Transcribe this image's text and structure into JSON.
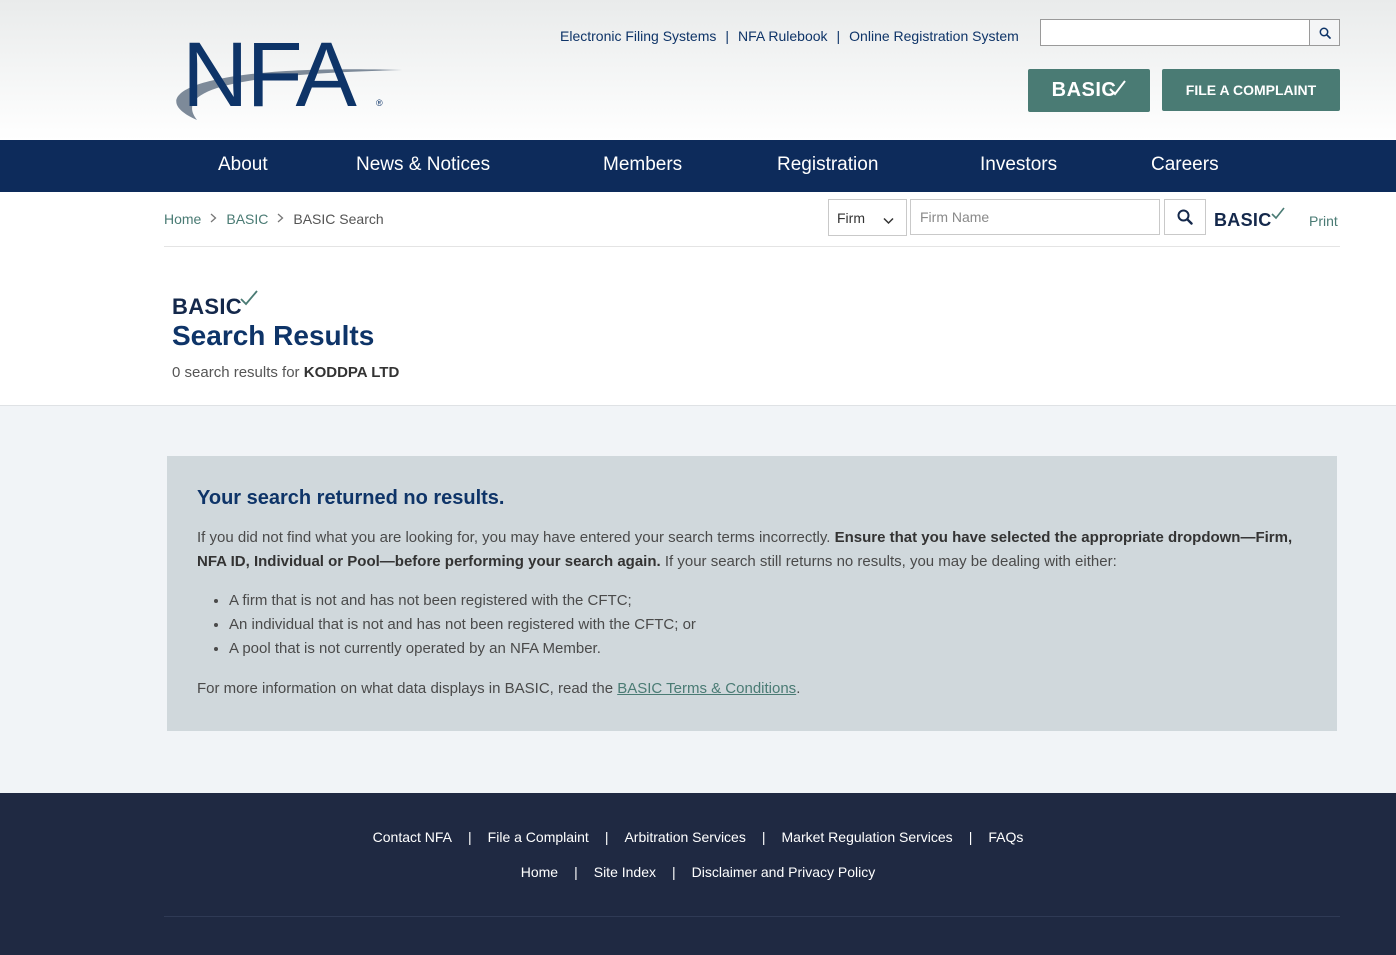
{
  "header": {
    "logo_text": "NFA",
    "utility_links": [
      "Electronic Filing Systems",
      "NFA Rulebook",
      "Online Registration System"
    ],
    "utility_separator": "|",
    "search_value": "",
    "basic_button": "BASIC",
    "complaint_button": "FILE A COMPLAINT"
  },
  "nav": {
    "items": [
      "About",
      "News & Notices",
      "Members",
      "Registration",
      "Investors",
      "Careers"
    ]
  },
  "breadcrumb": {
    "items": [
      "Home",
      "BASIC",
      "BASIC Search"
    ]
  },
  "basic_search": {
    "type_selected": "Firm",
    "name_placeholder": "Firm Name",
    "logo_text": "BASIC",
    "print_label": "Print"
  },
  "results": {
    "logo_text": "BASIC",
    "title": "Search Results",
    "count_prefix": "0 search results for",
    "query": "KODDPA LTD"
  },
  "no_results": {
    "title": "Your search returned no results.",
    "intro": "If you did not find what you are looking for, you may have entered your search terms incorrectly.",
    "bold": "Ensure that you have selected the appropriate dropdown—Firm, NFA ID, Individual or Pool—before performing your search again.",
    "outro": "If your search still returns no results, you may be dealing with either:",
    "list": [
      "A firm that is not and has not been registered with the CFTC;",
      "An individual that is not and has not been registered with the CFTC; or",
      "A pool that is not currently operated by an NFA Member."
    ],
    "more_prefix": "For more information on what data displays in BASIC, read the",
    "more_link": "BASIC Terms & Conditions",
    "more_suffix": "."
  },
  "footer": {
    "row1": [
      "Contact NFA",
      "File a Complaint",
      "Arbitration Services",
      "Market Regulation Services",
      "FAQs"
    ],
    "row2": [
      "Home",
      "Site Index",
      "Disclaimer and Privacy Policy"
    ],
    "separator": "|"
  },
  "colors": {
    "navy": "#0d2b5b",
    "teal": "#4a7b74",
    "footer": "#1f2942",
    "box": "#d0d8dc"
  }
}
